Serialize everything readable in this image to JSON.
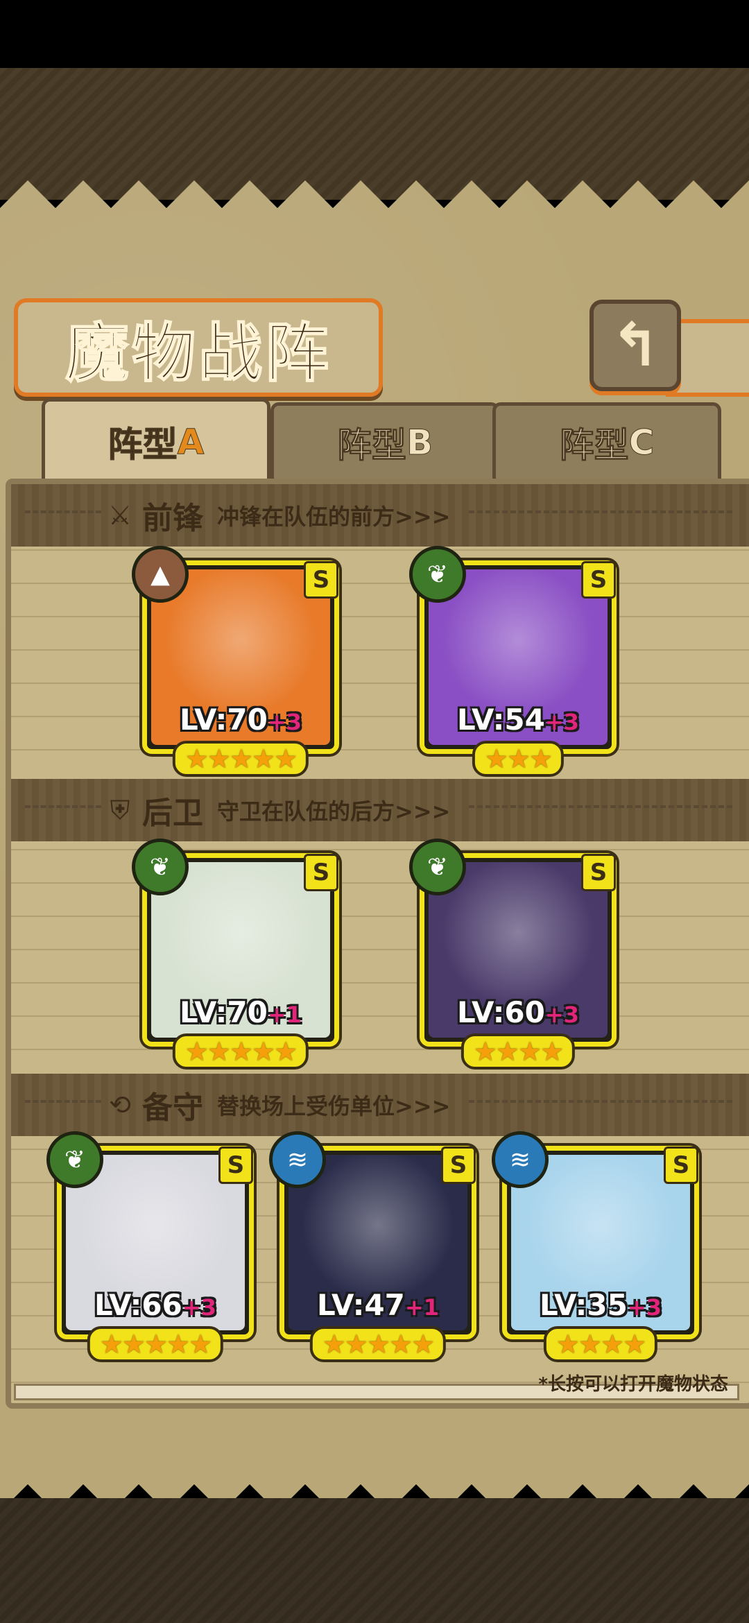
{
  "title": "魔物战阵",
  "back_icon": "back-arrow-icon",
  "tabs": [
    {
      "prefix": "阵型",
      "letter": "A",
      "active": true
    },
    {
      "prefix": "阵型",
      "letter": "B",
      "active": false
    },
    {
      "prefix": "阵型",
      "letter": "C",
      "active": false
    }
  ],
  "sections": [
    {
      "key": "front",
      "icon": "sword-icon",
      "icon_char": "⚔",
      "title": "前锋",
      "desc": "冲锋在队伍的前方>>>",
      "cards": [
        {
          "element": "rock",
          "rank": "S",
          "level": "LV:70",
          "plus": "+3",
          "stars": "★★★★★",
          "portrait_bg": "#e87a2a"
        },
        {
          "element": "leaf",
          "rank": "S",
          "level": "LV:54",
          "plus": "+3",
          "stars": "★★★",
          "portrait_bg": "#8a4fc4"
        }
      ]
    },
    {
      "key": "back",
      "icon": "shield-icon",
      "icon_char": "⛨",
      "title": "后卫",
      "desc": "守卫在队伍的后方>>>",
      "cards": [
        {
          "element": "leaf",
          "rank": "S",
          "level": "LV:70",
          "plus": "+1",
          "stars": "★★★★★",
          "portrait_bg": "#d8e2d2"
        },
        {
          "element": "leaf",
          "rank": "S",
          "level": "LV:60",
          "plus": "+3",
          "stars": "★★★★",
          "portrait_bg": "#4a3a6a"
        }
      ]
    },
    {
      "key": "reserve",
      "icon": "swap-icon",
      "icon_char": "⟲",
      "title": "备守",
      "desc": "替换场上受伤单位>>>",
      "cards": [
        {
          "element": "leaf",
          "rank": "S",
          "level": "LV:66",
          "plus": "+3",
          "stars": "★★★★★",
          "portrait_bg": "#d9d9e0"
        },
        {
          "element": "water",
          "rank": "S",
          "level": "LV:47",
          "plus": "+1",
          "stars": "★★★★★",
          "portrait_bg": "#2a2c4a"
        },
        {
          "element": "water",
          "rank": "S",
          "level": "LV:35",
          "plus": "+3",
          "stars": "★★★★",
          "portrait_bg": "#a8d4ec"
        }
      ]
    }
  ],
  "hint": "*长按可以打开魔物状态",
  "element_icons": {
    "leaf": "❦",
    "water": "≋",
    "rock": "▲"
  }
}
